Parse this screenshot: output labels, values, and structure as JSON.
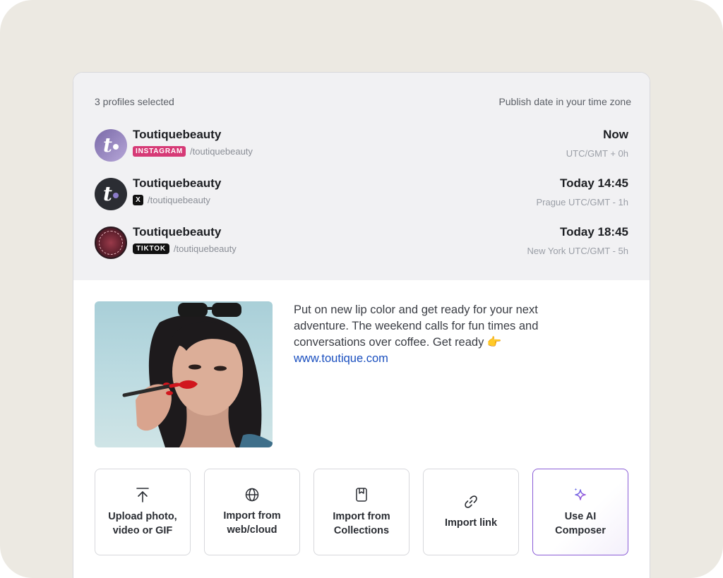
{
  "header": {
    "selected": "3 profiles selected",
    "tz_label": "Publish date in your time zone"
  },
  "profiles": [
    {
      "name": "Toutiquebeauty",
      "network": "INSTAGRAM",
      "handle": "/toutiquebeauty",
      "time": "Now",
      "tz": "UTC/GMT + 0h",
      "avatar_letter": "t"
    },
    {
      "name": "Toutiquebeauty",
      "network": "X",
      "handle": "/toutiquebeauty",
      "time": "Today 14:45",
      "tz": "Prague UTC/GMT - 1h",
      "avatar_letter": "t"
    },
    {
      "name": "Toutiquebeauty",
      "network": "TIKTOK",
      "handle": "/toutiquebeauty",
      "time": "Today 18:45",
      "tz": "New York UTC/GMT - 5h",
      "avatar_letter": ""
    }
  ],
  "post": {
    "text": "Put on new lip color and get ready for your next adventure. The weekend calls for fun times and conversations over coffee. Get ready 👉",
    "link": "www.toutique.com"
  },
  "actions": [
    {
      "label": "Upload photo,\nvideo or GIF",
      "icon": "upload-icon"
    },
    {
      "label": "Import from\nweb/cloud",
      "icon": "globe-icon"
    },
    {
      "label": "Import from\nCollections",
      "icon": "collections-icon"
    },
    {
      "label": "Import link",
      "icon": "link-icon"
    },
    {
      "label": "Use AI\nComposer",
      "icon": "sparkle-icon"
    }
  ],
  "colors": {
    "instagram_badge": "#d63a76",
    "ai_accent": "#8a5cd6",
    "link": "#1a4fbf"
  }
}
